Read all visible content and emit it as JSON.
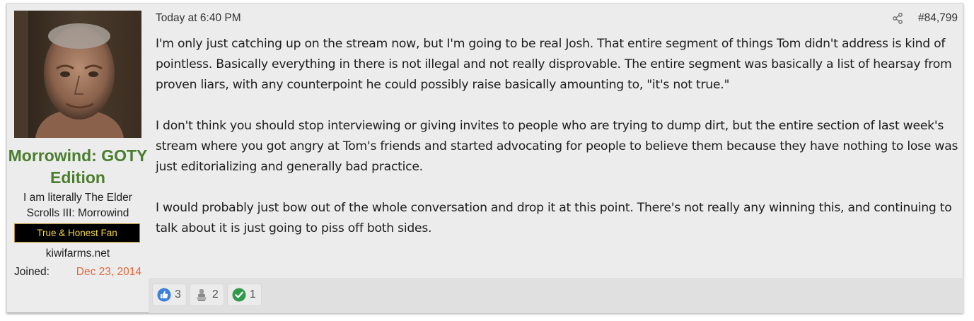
{
  "user": {
    "name": "Morrowind: GOTY Edition",
    "title": "I am literally The Elder Scrolls III: Morrowind",
    "banner": "True & Honest Fan",
    "site": "kiwifarms.net",
    "joined_label": "Joined:",
    "joined_date": "Dec 23, 2014",
    "avatar_icon": "avatar"
  },
  "post": {
    "timestamp": "Today at 6:40 PM",
    "number": "#84,799",
    "share_icon": "share-icon",
    "paragraphs": [
      "I'm only just catching up on the stream now, but I'm going to be real Josh. That entire segment of things Tom didn't address is kind of pointless. Basically everything in there is not illegal and not really disprovable. The entire segment was basically a list of hearsay from proven liars, with any counterpoint he could possibly raise basically amounting to, \"it's not true.\"",
      "I don't think you should stop interviewing or giving invites to people who are trying to dump dirt, but the entire section of last week's stream where you got angry at Tom's friends and started advocating for people to believe them because they have nothing to lose was just editorializing and generally bad practice.",
      "I would probably just bow out of the whole conversation and drop it at this point. There's not really any winning this, and continuing to talk about it is just going to piss off both sides."
    ]
  },
  "reactions": [
    {
      "icon": "thumbs-up-icon",
      "count": "3"
    },
    {
      "icon": "rubber-stamp-icon",
      "count": "2"
    },
    {
      "icon": "checkmark-icon",
      "count": "1"
    }
  ],
  "colors": {
    "username": "#4a7d2e",
    "joined_date": "#e06a3c",
    "banner_bg": "#000000",
    "banner_text": "#f2d44a"
  }
}
